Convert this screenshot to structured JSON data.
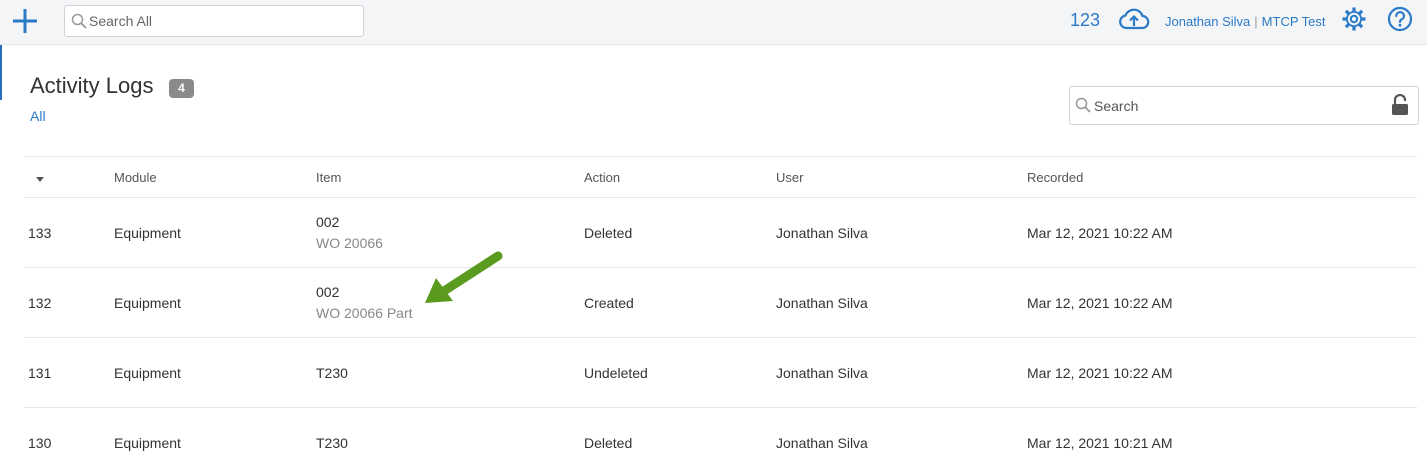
{
  "topbar": {
    "search_placeholder": "Search All",
    "count": "123",
    "user_name": "Jonathan Silva",
    "separator": "|",
    "account": "MTCP Test"
  },
  "page": {
    "title": "Activity Logs",
    "badge": "4",
    "filter": "All",
    "search_placeholder": "Search"
  },
  "table": {
    "headers": {
      "id": "",
      "module": "Module",
      "item": "Item",
      "action": "Action",
      "user": "User",
      "recorded": "Recorded"
    },
    "rows": [
      {
        "id": "133",
        "module": "Equipment",
        "item": "002",
        "item_sub": "WO 20066",
        "action": "Deleted",
        "user": "Jonathan Silva",
        "recorded": "Mar 12, 2021 10:22 AM"
      },
      {
        "id": "132",
        "module": "Equipment",
        "item": "002",
        "item_sub": "WO 20066 Part",
        "action": "Created",
        "user": "Jonathan Silva",
        "recorded": "Mar 12, 2021 10:22 AM"
      },
      {
        "id": "131",
        "module": "Equipment",
        "item": "T230",
        "item_sub": "",
        "action": "Undeleted",
        "user": "Jonathan Silva",
        "recorded": "Mar 12, 2021 10:22 AM"
      },
      {
        "id": "130",
        "module": "Equipment",
        "item": "T230",
        "item_sub": "",
        "action": "Deleted",
        "user": "Jonathan Silva",
        "recorded": "Mar 12, 2021 10:21 AM"
      }
    ]
  },
  "icons": {
    "add": "plus-icon",
    "search": "search-icon",
    "upload": "cloud-upload-icon",
    "settings": "gear-icon",
    "help": "help-icon",
    "lock": "unlock-icon",
    "sort": "sort-down-icon",
    "annotation": "green-arrow-icon"
  },
  "colors": {
    "accent": "#2a7ac7",
    "badge": "#8a8a8a",
    "annotation": "#5a9a1e"
  }
}
